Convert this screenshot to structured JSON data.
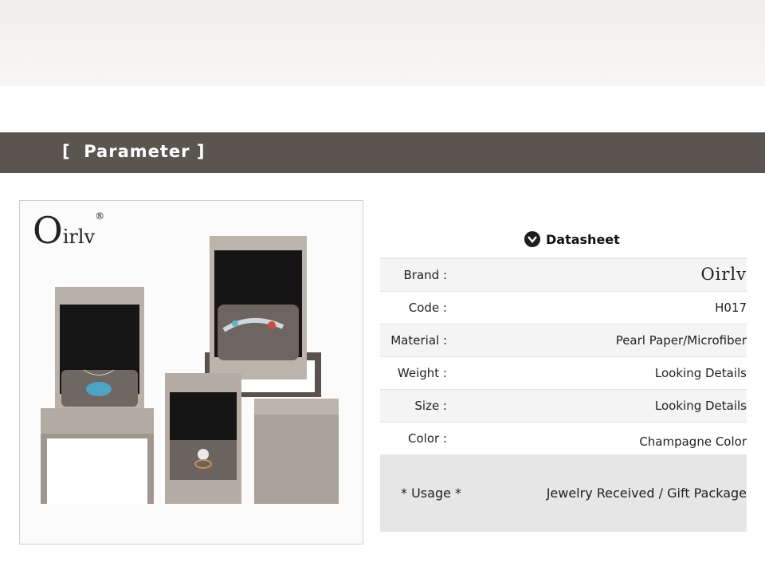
{
  "header": {
    "title": "[  Parameter ]"
  },
  "photo": {
    "logo_first": "O",
    "logo_rest": "irlv",
    "logo_reg": "®"
  },
  "datasheet": {
    "title": "Datasheet",
    "rows": [
      {
        "label": "Brand :",
        "value": "Oirlv"
      },
      {
        "label": "Code :",
        "value": "H017"
      },
      {
        "label": "Material :",
        "value": "Pearl Paper/Microfiber"
      },
      {
        "label": "Weight :",
        "value": "Looking Details"
      },
      {
        "label": "Size :",
        "value": "Looking Details"
      },
      {
        "label": "Color :",
        "value": "Champagne Color"
      }
    ],
    "usage": {
      "label": "* Usage *",
      "value": "Jewelry Received / Gift Package"
    }
  },
  "colors": {
    "header_bar": "#5b5550",
    "box_shell": "#b8b0a6",
    "box_inner": "#1a1a1a",
    "cushion": "#6e6660"
  }
}
